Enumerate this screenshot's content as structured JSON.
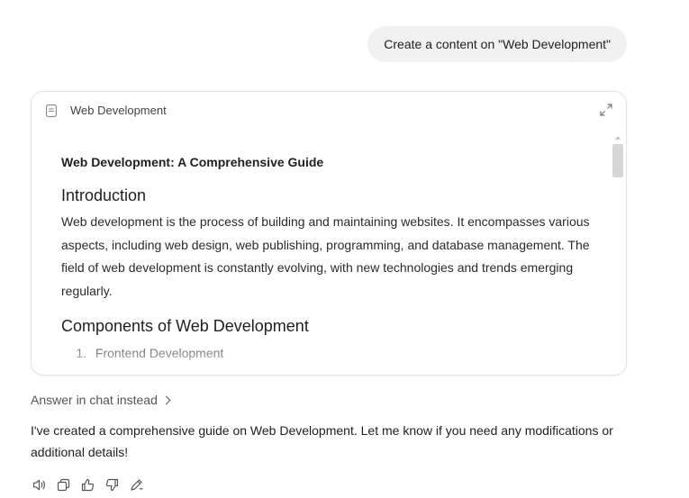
{
  "user_message": "Create a content on \"Web Development\"",
  "doc_card": {
    "title": "Web Development",
    "heading": "Web Development: A Comprehensive Guide",
    "intro_heading": "Introduction",
    "intro_text": "Web development is the process of building and maintaining websites. It encompasses various aspects, including web design, web publishing, programming, and database management. The field of web development is constantly evolving, with new technologies and trends emerging regularly.",
    "components_heading": "Components of Web Development",
    "list": [
      {
        "number": "1.",
        "label": "Frontend Development"
      }
    ]
  },
  "answer_link": "Answer in chat instead",
  "assistant_message": "I've created a comprehensive guide on Web Development. Let me know if you need any modifications or additional details!",
  "actions": [
    "speaker-icon",
    "copy-icon",
    "thumbs-up-icon",
    "thumbs-down-icon",
    "edit-icon"
  ],
  "colors": {
    "bubble_bg": "#f1f1f1",
    "card_border": "#e2e2e2",
    "text": "#1f1f1f"
  }
}
